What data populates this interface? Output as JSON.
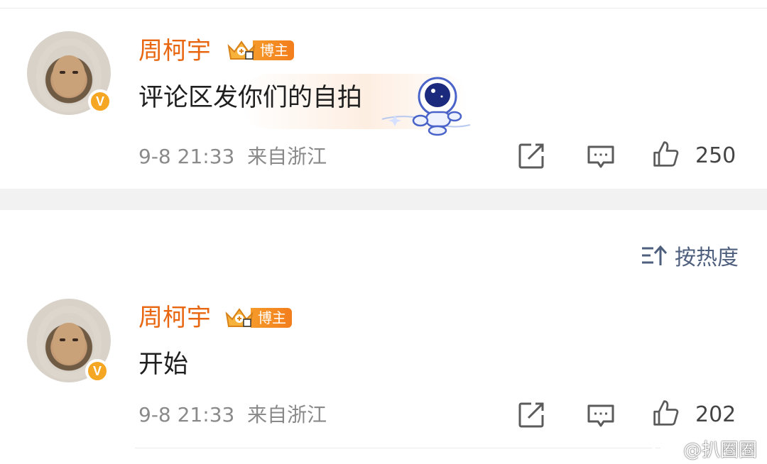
{
  "comments": [
    {
      "username": "周柯宇",
      "badge_label": "博主",
      "text": "评论区发你们的自拍",
      "timestamp": "9-8 21:33",
      "location": "来自浙江",
      "likes": "250",
      "has_sticker": true,
      "sticker": "astronaut-sticker"
    },
    {
      "username": "周柯宇",
      "badge_label": "博主",
      "text": "开始",
      "timestamp": "9-8 21:33",
      "location": "来自浙江",
      "likes": "202",
      "has_sticker": false
    }
  ],
  "verified_mark": "V",
  "sort": {
    "label": "按热度",
    "icon": "sort-icon"
  },
  "watermark": {
    "text": "@扒圈圈",
    "icon": "weibo-logo"
  },
  "colors": {
    "username": "#e8660f",
    "badge": "#f37d1c",
    "verified": "#f5a623",
    "sort": "#4e5f7e",
    "meta": "#8a8a8a",
    "separator": "#f2f2f2"
  }
}
